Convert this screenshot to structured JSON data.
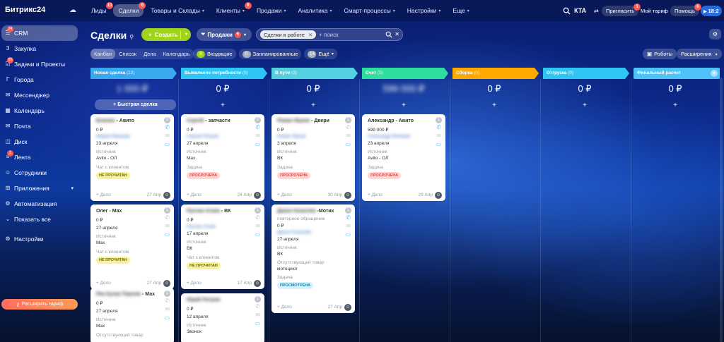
{
  "app": {
    "logo": "Битрикс24",
    "logo_suffix": "☁"
  },
  "nav": [
    {
      "label": "Лиды",
      "badge": "10",
      "active": false,
      "caret": false
    },
    {
      "label": "Сделки",
      "badge": "6",
      "active": true,
      "caret": false
    },
    {
      "label": "Товары и Склады",
      "badge": "",
      "active": false,
      "caret": true
    },
    {
      "label": "Клиенты",
      "badge": "8",
      "active": false,
      "caret": true
    },
    {
      "label": "Продажи",
      "badge": "",
      "active": false,
      "caret": true
    },
    {
      "label": "Аналитика",
      "badge": "",
      "active": false,
      "caret": true
    },
    {
      "label": "Смарт-процессы",
      "badge": "",
      "active": false,
      "caret": true
    },
    {
      "label": "Настройки",
      "badge": "",
      "active": false,
      "caret": true
    },
    {
      "label": "Еще",
      "badge": "",
      "active": false,
      "caret": true
    }
  ],
  "topright": {
    "search_icon": "search-icon",
    "company": "КТА",
    "invite": "Пригласить",
    "invite_badge": "1",
    "tariff": "Мой тариф",
    "help": "Помощь",
    "help_badge": "6",
    "time": "18:2"
  },
  "sidebar": {
    "items": [
      {
        "label": "CRM",
        "icon": "☰",
        "badge": "24",
        "active": true
      },
      {
        "label": "Закупка",
        "icon": "З",
        "badge": "",
        "active": false
      },
      {
        "label": "Задачи и Проекты",
        "icon": "☑",
        "badge": "55",
        "active": false
      },
      {
        "label": "Города",
        "icon": "Г",
        "badge": "",
        "active": false
      },
      {
        "label": "Мессенджер",
        "icon": "✉",
        "badge": "",
        "active": false
      },
      {
        "label": "Календарь",
        "icon": "▦",
        "badge": "",
        "active": false
      },
      {
        "label": "Почта",
        "icon": "✉",
        "badge": "",
        "active": false
      },
      {
        "label": "Диск",
        "icon": "◫",
        "badge": "",
        "active": false
      },
      {
        "label": "Лента",
        "icon": "≡",
        "badge": "1",
        "active": false
      },
      {
        "label": "Сотрудники",
        "icon": "☺",
        "badge": "",
        "active": false
      },
      {
        "label": "Приложения",
        "icon": "⊞",
        "badge": "",
        "active": false
      },
      {
        "label": "Автоматизация",
        "icon": "⚙",
        "badge": "",
        "active": false
      },
      {
        "label": "Показать все",
        "icon": "⌄",
        "badge": "",
        "active": false
      },
      {
        "label": "Настройки",
        "icon": "⚙",
        "badge": "",
        "active": false
      }
    ],
    "upgrade": "Расширить тариф"
  },
  "toolbar": {
    "title": "Сделки",
    "create": "Создать",
    "sales": "Продажи",
    "sales_badge": "6",
    "filter_chip": "Сделки в работе",
    "search_placeholder": "+ поиск"
  },
  "views": [
    "Канбан",
    "Список",
    "Дела",
    "Календарь"
  ],
  "counters": [
    {
      "num": "6",
      "label": "Входящие",
      "color": "#9fd41a"
    },
    {
      "num": "0",
      "label": "Запланированные",
      "color": "#aab3bd"
    },
    {
      "num": "14",
      "label": "Ещё",
      "color": "#aab3bd"
    }
  ],
  "right_buttons": {
    "robots": "Роботы",
    "extensions": "Расширения"
  },
  "columns": [
    {
      "name": "Новая сделка",
      "count": "(22)",
      "color": "#39a8ef",
      "sum": "1 000 ₽",
      "sum_blur": true,
      "quick": "Быстрая сделка"
    },
    {
      "name": "Выявление потребности",
      "count": "(9)",
      "color": "#2fc6f6",
      "sum": "0 ₽",
      "sum_blur": false,
      "quick": ""
    },
    {
      "name": "В пути",
      "count": "(3)",
      "color": "#55d0e0",
      "sum": "0 ₽",
      "sum_blur": false,
      "quick": ""
    },
    {
      "name": "Счет",
      "count": "(5)",
      "color": "#2fde9f",
      "sum": "599 000 ₽",
      "sum_blur": true,
      "quick": ""
    },
    {
      "name": "Сборка",
      "count": "(0)",
      "color": "#ffa900",
      "sum": "0 ₽",
      "sum_blur": false,
      "quick": ""
    },
    {
      "name": "Отгрузка",
      "count": "(0)",
      "color": "#2fc6f6",
      "sum": "0 ₽",
      "sum_blur": false,
      "quick": ""
    },
    {
      "name": "Финальный расчет",
      "count": "",
      "color": "#4fc3f7",
      "sum": "0 ₽",
      "sum_blur": false,
      "quick": ""
    }
  ],
  "cards": {
    "c0a": {
      "title_prefix": "Блинин",
      "title": " - Авито",
      "num": "0",
      "amount": "0 ₽",
      "contact": "Мария Иванова",
      "date": "23 апреля",
      "src_label": "Источник",
      "src": "Avito - ОЛ",
      "chat": "Чат с клиентом",
      "tag": "НЕ ПРОЧИТАН",
      "foot": "+ Дело",
      "fdate": "27 Апр"
    },
    "c0b": {
      "title": "Олег - Мах",
      "num": "1",
      "amount": "0 ₽",
      "date": "27 апреля",
      "src_label": "Источник",
      "src": "Max",
      "chat": "Чат с клиентом",
      "tag": "НЕ ПРОЧИТАН",
      "foot": "+ Дело",
      "fdate": "27 Апр"
    },
    "c0c": {
      "title_prefix": "Рик Кулан Павлов",
      "title": " - Мах",
      "num": "1",
      "amount": "0 ₽",
      "date": "27 апреля",
      "src_label": "Источник",
      "src": "Max",
      "extra": "Отсутствующий товар"
    },
    "c1a": {
      "title_prefix": "Сергей",
      "title": " - запчасти",
      "num": "0",
      "amount": "0 ₽",
      "contact": "Сергей Петров",
      "date": "27 апреля",
      "src_label": "Источник",
      "src": "Max",
      "task_label": "Задача",
      "tag": "ПРОСРОЧЕНА",
      "foot": "+ Дело",
      "fdate": "24 Апр"
    },
    "c1b": {
      "title_prefix": "Руслан Агаев",
      "title": " - ВК",
      "num": "1",
      "amount": "0 ₽",
      "contact": "Руслан Агаев",
      "date": "17 апреля",
      "src_label": "Источник",
      "src": "ВК",
      "chat": "Чат с клиентом",
      "tag": "НЕ ПРОЧИТАН",
      "foot": "+ Дело",
      "fdate": "17 Апр"
    },
    "c1c": {
      "title_prefix": "Юрий Петров",
      "title": "",
      "num": "1",
      "amount": "0 ₽",
      "date": "12 апреля",
      "src_label": "Источник",
      "src": "Звонок"
    },
    "c2a": {
      "title_prefix": "Роман Жуков",
      "title": " - Двери",
      "num": "1",
      "amount": "0 ₽",
      "contact": "Роман Жуков",
      "date": "3 апреля",
      "src_label": "Источник",
      "src": "ВК",
      "task_label": "Задача",
      "tag": "ПРОСРОЧЕНА",
      "foot": "+ Дело",
      "fdate": "30 Апр"
    },
    "c2b": {
      "title_prefix": "Данил Кошелев",
      "title": " -Мотик",
      "num": "1",
      "note": "повторное обращение",
      "amount": "0 ₽",
      "contact": "Данил Кошелев",
      "date": "27 апреля",
      "src_label": "Источник",
      "src": "ВК",
      "extra_label": "Отсутствующий товар",
      "extra": "мотоцикл",
      "task_label": "Задача",
      "tag": "ПРОСМОТРЕНА",
      "foot": "+ Дело",
      "fdate": "27 Апр"
    },
    "c3a": {
      "title": "Александр - Авито",
      "num": "1",
      "amount": "599 000 ₽",
      "contact": "Александр Матвеев",
      "date": "23 апреля",
      "src_label": "Источник",
      "src": "Avito - ОЛ",
      "task_label": "Задача",
      "tag": "ПРОСРОЧЕНА",
      "foot": "+ Дело",
      "fdate": "29 Апр"
    }
  }
}
